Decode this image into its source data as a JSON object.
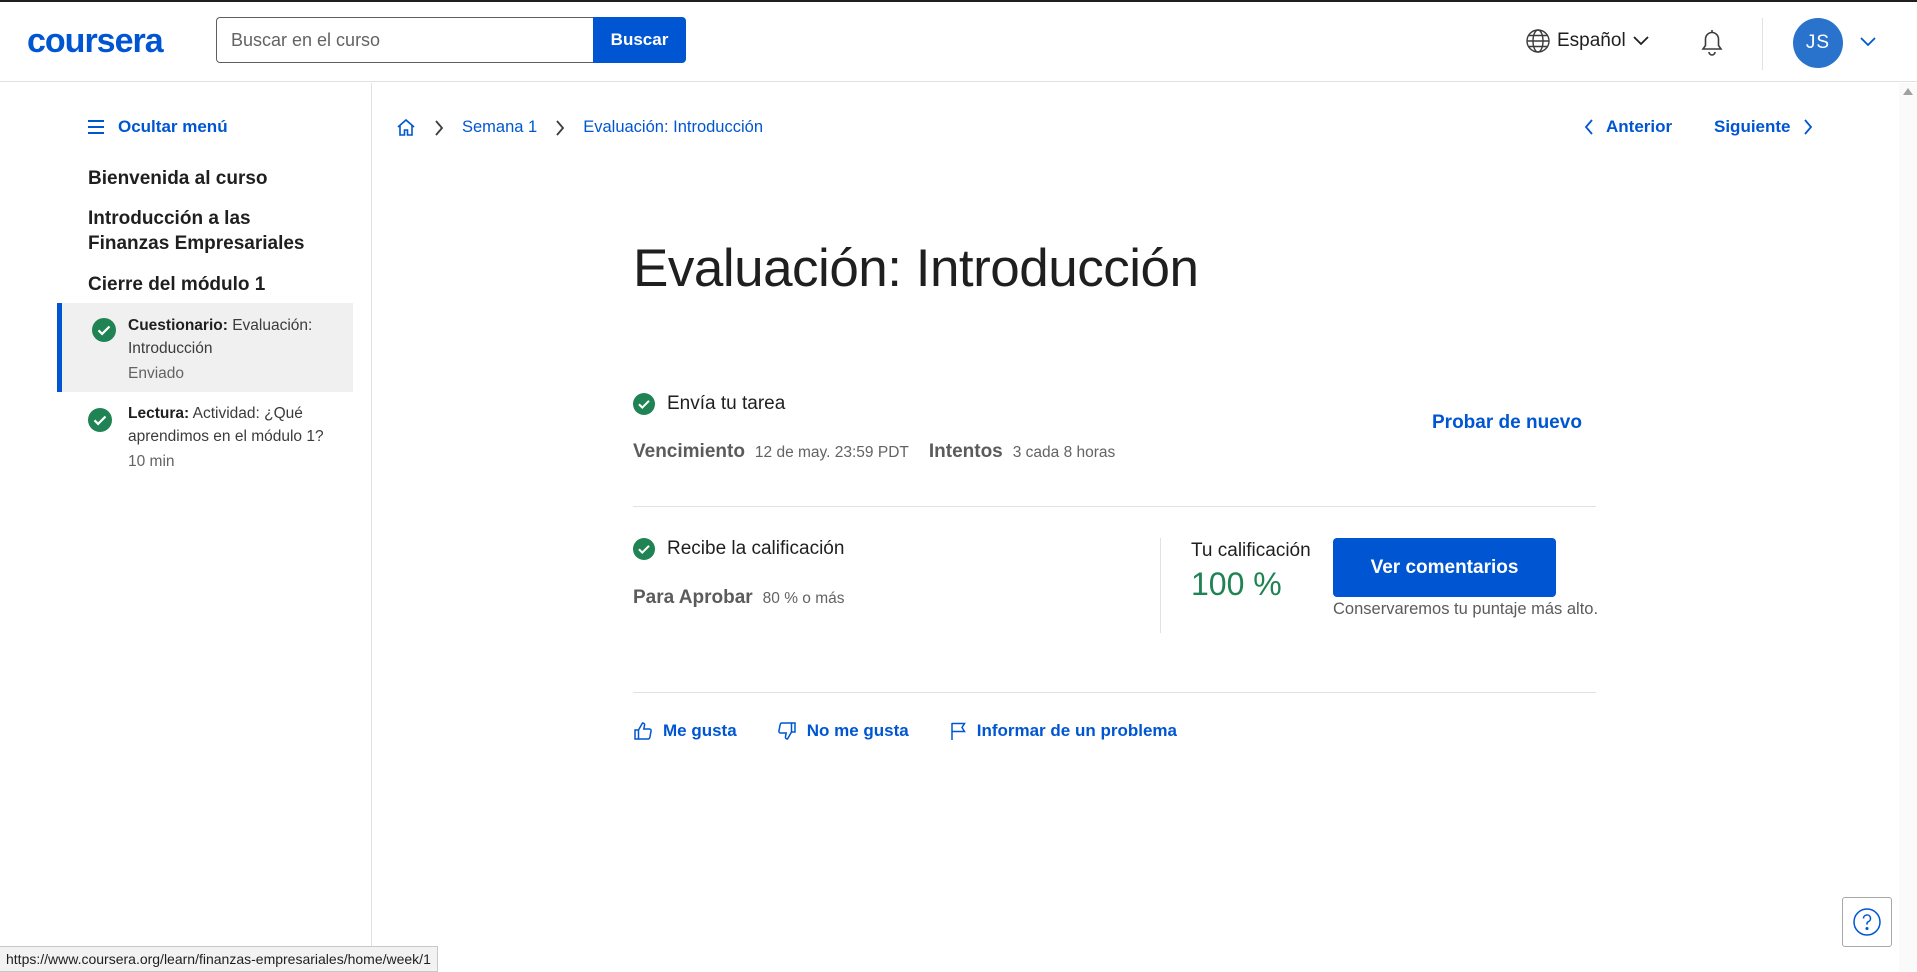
{
  "header": {
    "logo": "coursera",
    "search_placeholder": "Buscar en el curso",
    "search_button": "Buscar",
    "language": "Español",
    "avatar_initials": "JS"
  },
  "sidebar": {
    "hide_menu": "Ocultar menú",
    "sections": [
      "Bienvenida al curso",
      "Introducción a las Finanzas Empresariales",
      "Cierre del módulo 1"
    ],
    "items": [
      {
        "type": "Cuestionario:",
        "title": "Evaluación: Introducción",
        "meta": "Enviado",
        "active": true
      },
      {
        "type": "Lectura:",
        "title": "Actividad: ¿Qué aprendimos en el módulo 1?",
        "meta": "10 min",
        "active": false
      }
    ]
  },
  "breadcrumb": {
    "week": "Semana 1",
    "current": "Evaluación: Introducción"
  },
  "pager": {
    "prev": "Anterior",
    "next": "Siguiente"
  },
  "page_title": "Evaluación: Introducción",
  "submit": {
    "title": "Envía tu tarea",
    "due_label": "Vencimiento",
    "due_value": "12 de may. 23:59 PDT",
    "attempts_label": "Intentos",
    "attempts_value": "3 cada 8 horas",
    "retry": "Probar de nuevo"
  },
  "grade": {
    "title": "Recibe la calificación",
    "pass_label": "Para Aprobar",
    "pass_value": "80 % o más",
    "your_grade_label": "Tu calificación",
    "your_grade_value": "100 %",
    "feedback_button": "Ver comentarios",
    "note": "Conservaremos tu puntaje más alto."
  },
  "actions": {
    "like": "Me gusta",
    "dislike": "No me gusta",
    "report": "Informar de un problema"
  },
  "status_url": "https://www.coursera.org/learn/finanzas-empresariales/home/week/1",
  "colors": {
    "accent": "#0056d2",
    "success": "#1f8354"
  }
}
